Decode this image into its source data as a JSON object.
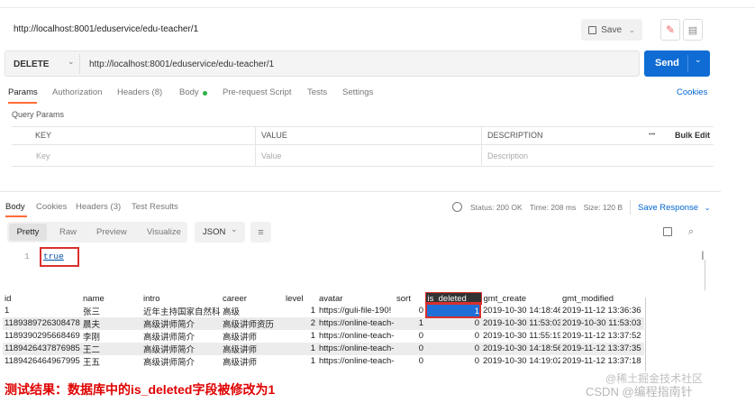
{
  "request": {
    "tab_title": "http://localhost:8001/eduservice/edu-teacher/1",
    "save_label": "Save",
    "method": "DELETE",
    "url": "http://localhost:8001/eduservice/edu-teacher/1",
    "send_label": "Send"
  },
  "req_tabs": [
    "Params",
    "Authorization",
    "Headers (8)",
    "Body",
    "Pre-request Script",
    "Tests",
    "Settings"
  ],
  "cookies_label": "Cookies",
  "query_params": {
    "title": "Query Params",
    "col_key": "KEY",
    "col_value": "VALUE",
    "col_desc": "DESCRIPTION",
    "more": "•••",
    "bulk_edit": "Bulk Edit",
    "ph_key": "Key",
    "ph_value": "Value",
    "ph_desc": "Description"
  },
  "resp_tabs": [
    "Body",
    "Cookies",
    "Headers (3)",
    "Test Results"
  ],
  "status": {
    "status": "Status: 200 OK",
    "time": "Time: 208 ms",
    "size": "Size: 120 B",
    "save_response": "Save Response"
  },
  "view_tabs": [
    "Pretty",
    "Raw",
    "Preview",
    "Visualize"
  ],
  "format": "JSON",
  "response_line_no": "1",
  "response_body": "true",
  "db": {
    "headers": [
      "id",
      "name",
      "intro",
      "career",
      "level",
      "avatar",
      "sort",
      "is_deleted",
      "gmt_create",
      "gmt_modified"
    ],
    "rows": [
      [
        "1",
        "张三",
        "近年主持国家自然科学基",
        "高级",
        "1",
        "https://guli-file-190!",
        "0",
        "1",
        "2019-10-30 14:18:46",
        "2019-11-12 13:36:36"
      ],
      [
        "1189389726308478",
        "晨夫",
        "高级讲师简介",
        "高级讲师资历",
        "2",
        "https://online-teach-",
        "1",
        "0",
        "2019-10-30 11:53:03",
        "2019-10-30 11:53:03"
      ],
      [
        "1189390295668469",
        "李刚",
        "高级讲师简介",
        "高级讲师",
        "1",
        "https://online-teach-",
        "0",
        "0",
        "2019-10-30 11:55:19",
        "2019-11-12 13:37:52"
      ],
      [
        "1189426437876985",
        "王二",
        "高级讲师简介",
        "高级讲师",
        "1",
        "https://online-teach-",
        "0",
        "0",
        "2019-10-30 14:18:56",
        "2019-11-12 13:37:35"
      ],
      [
        "1189426464967995",
        "王五",
        "高级讲师简介",
        "高级讲师",
        "1",
        "https://online-teach-",
        "0",
        "0",
        "2019-10-30 14:19:02",
        "2019-11-12 13:37:18"
      ]
    ]
  },
  "caption": "测试结果：数据库中的is_deleted字段被修改为1",
  "watermark": "CSDN @编程指南针",
  "watermark2": "@稀土掘金技术社区",
  "colors": {
    "accent": "#0265d2",
    "caption": "#e00000",
    "highlight": "#d9302c",
    "selected_cell": "#1e6fd8"
  }
}
